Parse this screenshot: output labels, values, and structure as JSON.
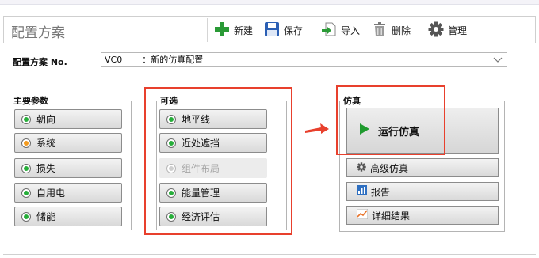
{
  "header": {
    "title": "配置方案",
    "toolbar": {
      "new_label": "新建",
      "save_label": "保存",
      "import_label": "导入",
      "delete_label": "删除",
      "manage_label": "管理"
    }
  },
  "config": {
    "label": "配置方案 No.",
    "code": "VC0",
    "name": "：新的仿真配置"
  },
  "main_params": {
    "title": "主要参数",
    "items": [
      {
        "label": "朝向",
        "indicator": "#27ae3a"
      },
      {
        "label": "系统",
        "indicator": "#f39a1e"
      },
      {
        "label": "损失",
        "indicator": "#27ae3a"
      },
      {
        "label": "自用电",
        "indicator": "#27ae3a"
      },
      {
        "label": "储能",
        "indicator": "#27ae3a"
      }
    ]
  },
  "optional": {
    "title": "可选",
    "items": [
      {
        "label": "地平线",
        "indicator": "#27ae3a"
      },
      {
        "label": "近处遮挡",
        "indicator": "#27ae3a"
      },
      {
        "label": "组件布局",
        "indicator": "#cfcfcf",
        "disabled": true
      },
      {
        "label": "能量管理",
        "indicator": "#27ae3a"
      },
      {
        "label": "经济评估",
        "indicator": "#27ae3a"
      }
    ]
  },
  "simulation": {
    "title": "仿真",
    "run_label": "运行仿真",
    "advanced_label": "高级仿真",
    "report_label": "报告",
    "detail_label": "详细结果"
  },
  "colors": {
    "accent_green": "#27ae3a",
    "warning_orange": "#f39a1e",
    "highlight_red": "#e8402d"
  }
}
